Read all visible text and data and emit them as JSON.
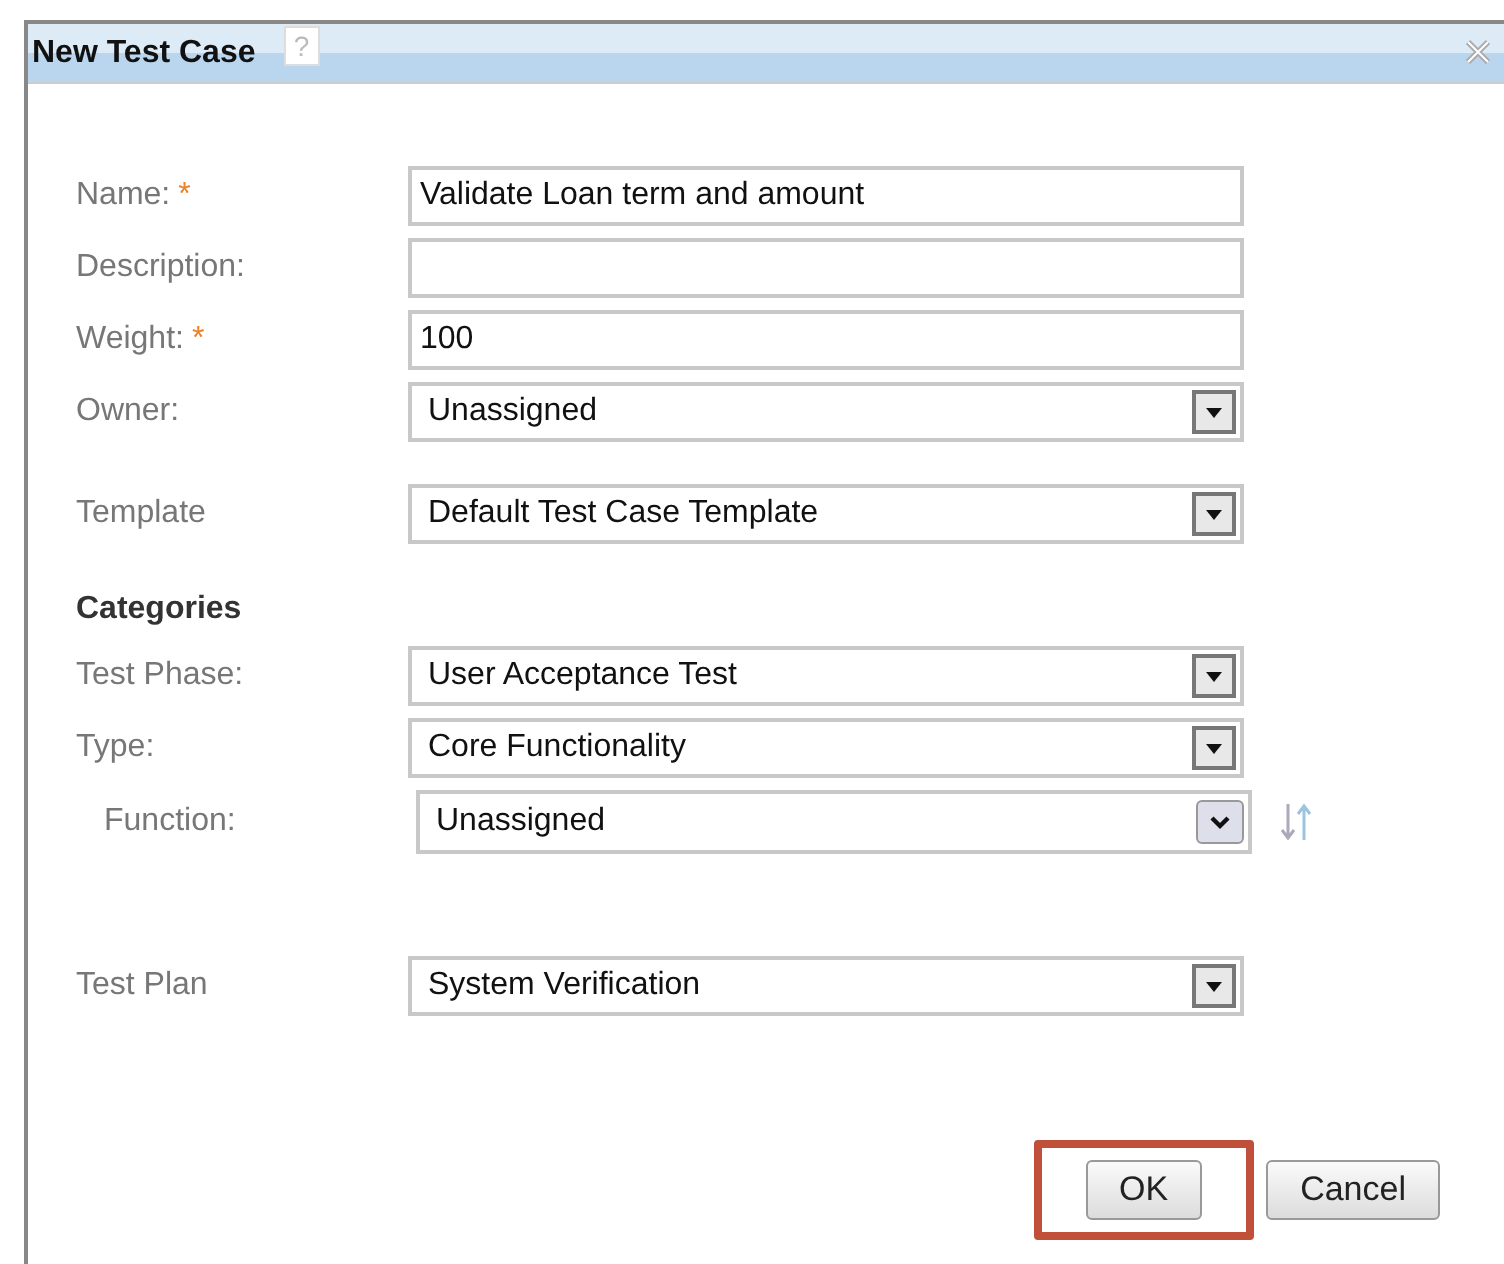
{
  "dialog": {
    "title": "New Test Case",
    "help_icon": "?"
  },
  "groups": [
    {
      "fields": [
        {
          "kind": "text",
          "label": "Name:",
          "required_mark": "*",
          "value": "Validate Loan term and amount"
        },
        {
          "kind": "text",
          "label": "Description:"
        },
        {
          "kind": "text",
          "label": "Weight:",
          "required_mark": "*",
          "value": "100"
        },
        {
          "kind": "select",
          "label": "Owner:",
          "value": "Unassigned"
        }
      ]
    },
    {
      "fields": [
        {
          "kind": "select",
          "label": "Template",
          "value": "Default Test Case Template"
        }
      ]
    },
    {
      "heading": "Categories",
      "fields": [
        {
          "kind": "select",
          "label": "Test Phase:",
          "value": "User Acceptance Test"
        },
        {
          "kind": "select",
          "label": "Type:",
          "value": "Core Functionality"
        },
        {
          "kind": "subselect",
          "label": "Function:",
          "value": "Unassigned"
        }
      ]
    },
    {
      "fields": [
        {
          "kind": "select",
          "label": "Test Plan",
          "value": "System Verification"
        }
      ]
    }
  ],
  "buttons": [
    {
      "label": "OK",
      "highlighted": true
    },
    {
      "label": "Cancel",
      "highlighted": false
    }
  ]
}
